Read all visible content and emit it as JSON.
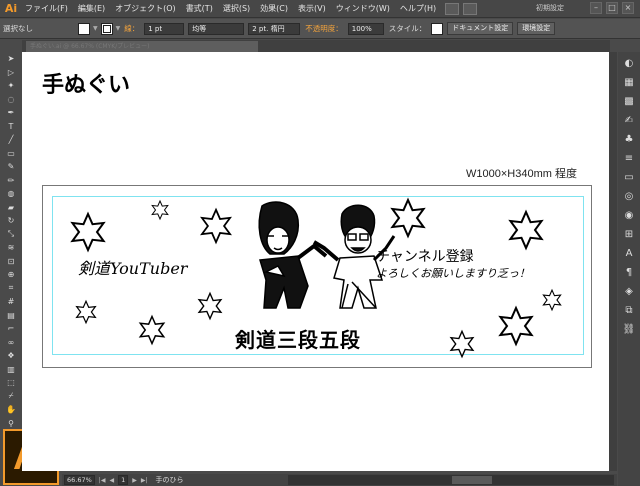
{
  "app": {
    "logo": "Ai",
    "badge_text": "Ai"
  },
  "menu": [
    "ファイル(F)",
    "編集(E)",
    "オブジェクト(O)",
    "書式(T)",
    "選択(S)",
    "効果(C)",
    "表示(V)",
    "ウィンドウ(W)",
    "ヘルプ(H)"
  ],
  "workspace_label": "初期設定",
  "control": {
    "selection": "選択なし",
    "stroke_label": "線：",
    "stroke_weight": "1 pt",
    "profile": "均等",
    "brush": "2 pt. 楕円",
    "opacity_label": "不透明度：",
    "opacity": "100%",
    "style_label": "スタイル：",
    "doc_settings": "ドキュメント設定",
    "preferences": "環境設定"
  },
  "document_tab": "手ぬぐい.ai @ 66.67% (CMYK/プレビュー)",
  "artboard": {
    "heading": "手ぬぐい",
    "size": "W1000×H340mm 程度",
    "left_text": "剣道YouTuber",
    "right_line1": "チャンネル登録",
    "right_line2": "よろしくお願いしますり乏っ！",
    "main_text": "剣道三段五段"
  },
  "status": {
    "zoom": "66.67%",
    "page": "1",
    "tool_name": "手のひら"
  },
  "colors": {
    "accent": "#f39a2b",
    "guide": "#7fe3f0",
    "ui_dark": "#4a4a4a"
  },
  "icons": {
    "tools": [
      "selection-arrow-icon",
      "direct-selection-icon",
      "magic-wand-icon",
      "lasso-icon",
      "pen-icon",
      "type-icon",
      "line-icon",
      "rectangle-icon",
      "paintbrush-icon",
      "pencil-icon",
      "blob-brush-icon",
      "eraser-icon",
      "rotate-icon",
      "scale-icon",
      "warp-icon",
      "free-transform-icon",
      "shape-builder-icon",
      "perspective-icon",
      "mesh-icon",
      "gradient-icon",
      "eyedropper-icon",
      "blend-icon",
      "symbol-sprayer-icon",
      "graph-icon",
      "artboard-icon",
      "slice-icon",
      "hand-icon",
      "zoom-icon"
    ],
    "panels": [
      "color-icon",
      "color-guide-icon",
      "swatches-icon",
      "brushes-icon",
      "symbols-icon",
      "stroke-icon",
      "gradient-panel-icon",
      "transparency-icon",
      "appearance-icon",
      "graphic-styles-icon",
      "layers-icon",
      "artboards-icon",
      "links-icon"
    ]
  }
}
